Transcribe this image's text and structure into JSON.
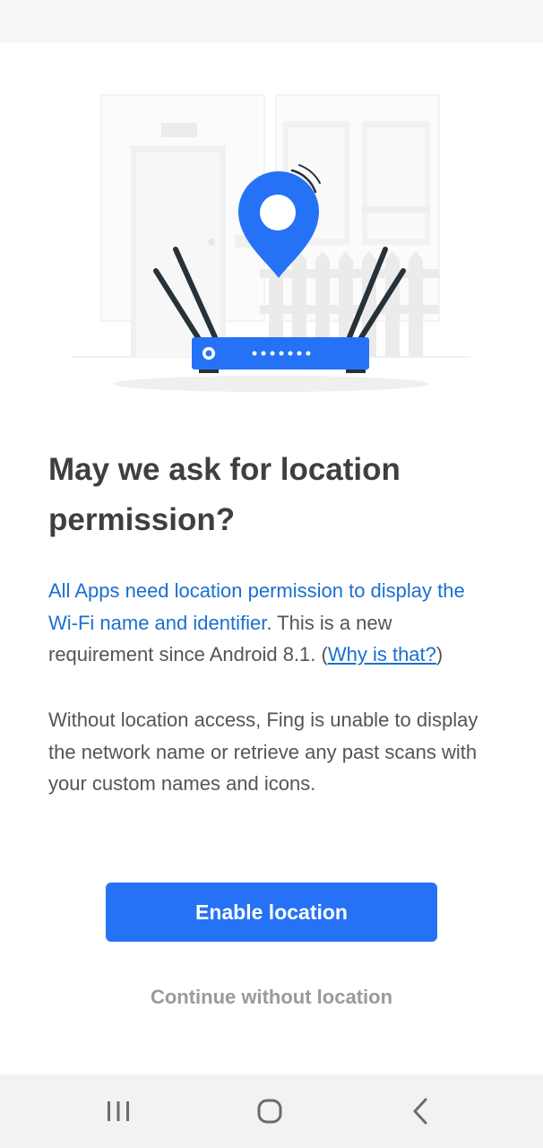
{
  "permission": {
    "title": "May we ask for location permission?",
    "paragraph1": {
      "highlight": "All Apps need location permission to display the Wi-Fi name and identifier",
      "text": ". This is a new requirement since Android 8.1. (",
      "link": "Why is that?",
      "close": ")"
    },
    "paragraph2": "Without location access, Fing is unable to display the network name or retrieve any past scans with your custom names and icons.",
    "enable_button": "Enable location",
    "continue_link": "Continue without location"
  },
  "illustration": {
    "icons": [
      "location-pin-icon",
      "wifi-router-icon",
      "door-icon",
      "window-icon",
      "fence-icon"
    ],
    "colors": {
      "accent": "#2672f6",
      "dark": "#263238",
      "background": "#f2f2f2"
    }
  },
  "nav": {
    "icons": [
      "recent-apps-icon",
      "home-icon",
      "back-icon"
    ]
  }
}
